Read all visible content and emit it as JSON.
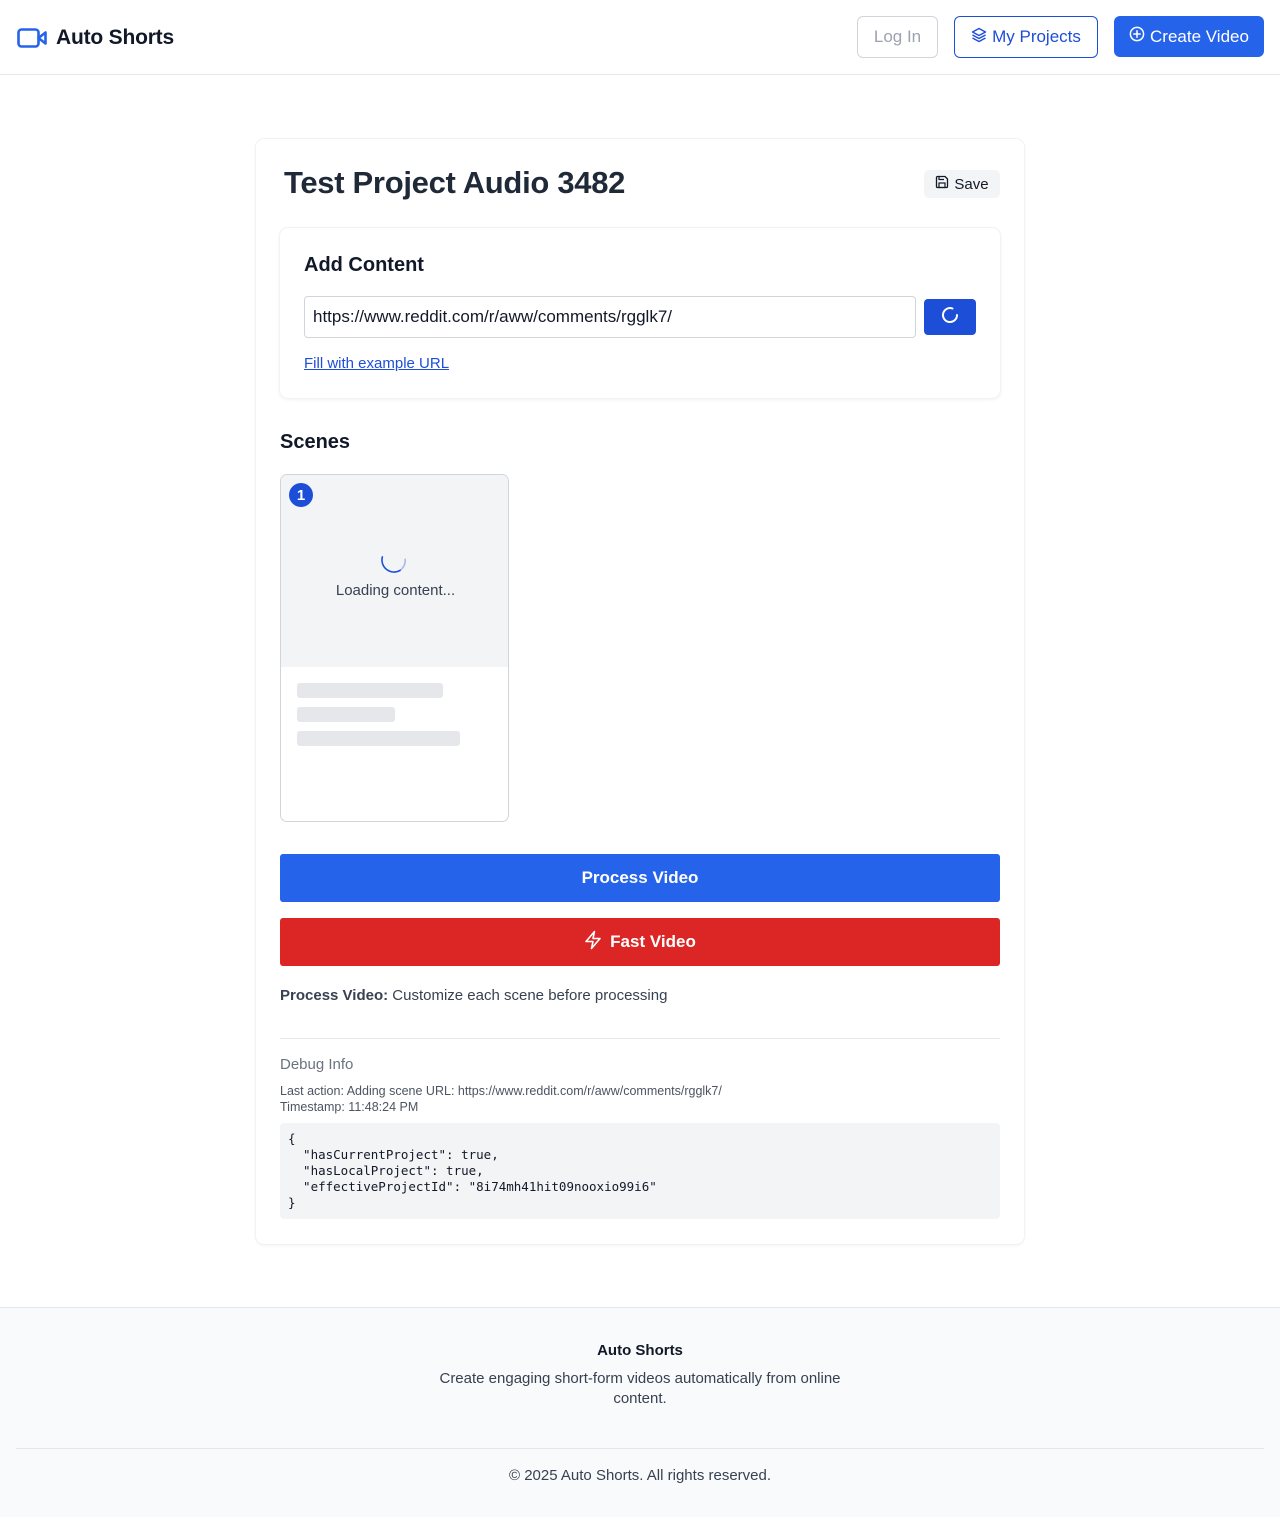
{
  "header": {
    "brand_name": "Auto Shorts",
    "brand_icon": "video-camera-icon",
    "login_label": "Log In",
    "projects_label": "My Projects",
    "projects_icon": "layers-icon",
    "create_label": "Create Video",
    "create_icon": "plus-circle-icon"
  },
  "project": {
    "title": "Test Project Audio 3482",
    "save_label": "Save",
    "save_icon": "floppy-disk-icon"
  },
  "add_content": {
    "title": "Add Content",
    "url_value": "https://www.reddit.com/r/aww/comments/rgglk7/",
    "load_icon": "spinner-icon",
    "example_link": "Fill with example URL"
  },
  "scenes": {
    "title": "Scenes",
    "items": [
      {
        "number": "1",
        "loading_text": "Loading content..."
      }
    ]
  },
  "actions": {
    "process_label": "Process Video",
    "fast_label": "Fast Video",
    "fast_icon": "lightning-icon",
    "note_bold": "Process Video:",
    "note_text": " Customize each scene before processing"
  },
  "debug": {
    "title": "Debug Info",
    "last_action": "Last action: Adding scene URL: https://www.reddit.com/r/aww/comments/rgglk7/",
    "timestamp": "Timestamp: 11:48:24 PM",
    "json": "{\n  \"hasCurrentProject\": true,\n  \"hasLocalProject\": true,\n  \"effectiveProjectId\": \"8i74mh41hit09nooxio99i6\"\n}"
  },
  "footer": {
    "title": "Auto Shorts",
    "description": "Create engaging short-form videos automatically from online content.",
    "copyright": "© 2025 Auto Shorts. All rights reserved."
  },
  "colors": {
    "primary": "#2563eb",
    "primary_dark": "#1d4ed8",
    "danger": "#dc2626",
    "border": "#e5e7eb"
  }
}
